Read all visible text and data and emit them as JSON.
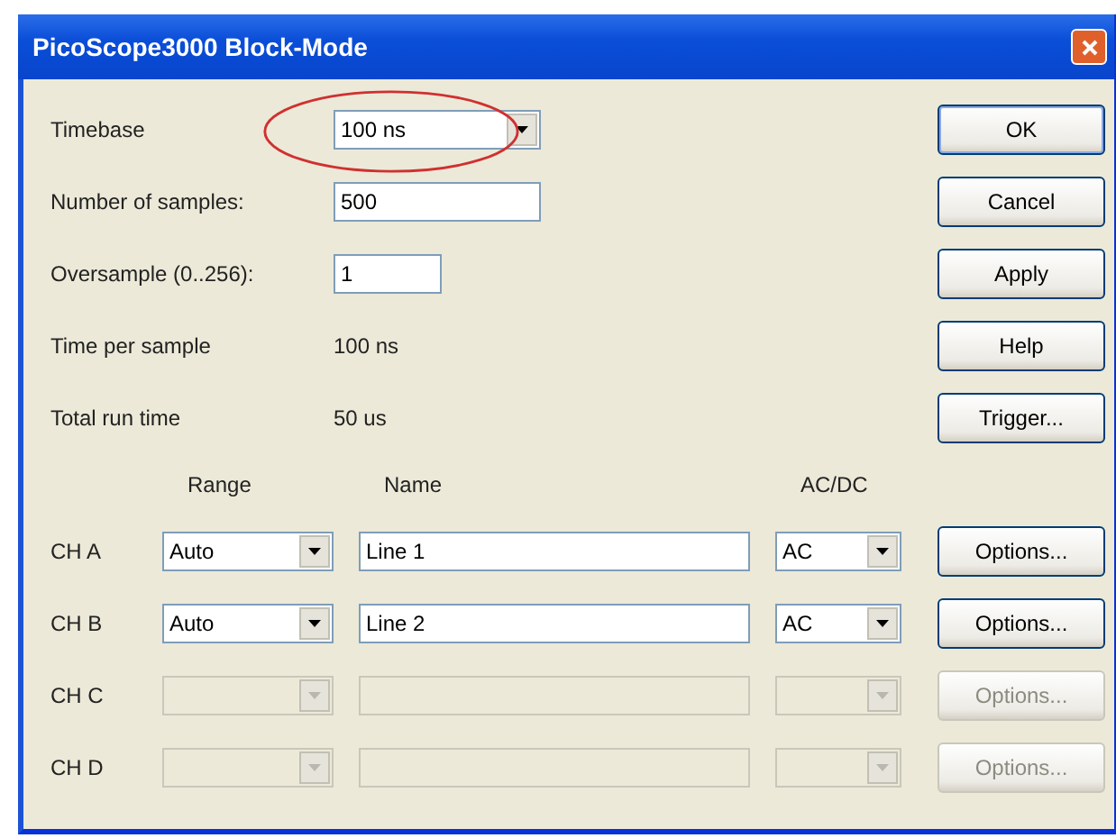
{
  "window": {
    "title": "PicoScope3000 Block-Mode"
  },
  "fields": [
    {
      "kind": "dropdown",
      "label": "Timebase",
      "value": "100 ns",
      "highlighted": true
    },
    {
      "kind": "text",
      "label": "Number of samples:",
      "value": "500",
      "highlighted": false
    },
    {
      "kind": "text",
      "label": "Oversample (0..256):",
      "value": "1",
      "highlighted": false
    }
  ],
  "readouts": [
    {
      "label": "Time per sample",
      "value": "100 ns"
    },
    {
      "label": "Total run time",
      "value": "50 us"
    }
  ],
  "buttons": [
    "OK",
    "Cancel",
    "Apply",
    "Help",
    "Trigger..."
  ],
  "channel_headers": [
    "Range",
    "Name",
    "AC/DC"
  ],
  "channels": [
    {
      "label": "CH A",
      "range": "Auto",
      "name": "Line 1",
      "coupling": "AC",
      "enabled": true,
      "options": "Options..."
    },
    {
      "label": "CH B",
      "range": "Auto",
      "name": "Line 2",
      "coupling": "AC",
      "enabled": true,
      "options": "Options..."
    },
    {
      "label": "CH C",
      "enabled": false,
      "options": "Options..."
    },
    {
      "label": "CH D",
      "enabled": false,
      "options": "Options..."
    }
  ]
}
